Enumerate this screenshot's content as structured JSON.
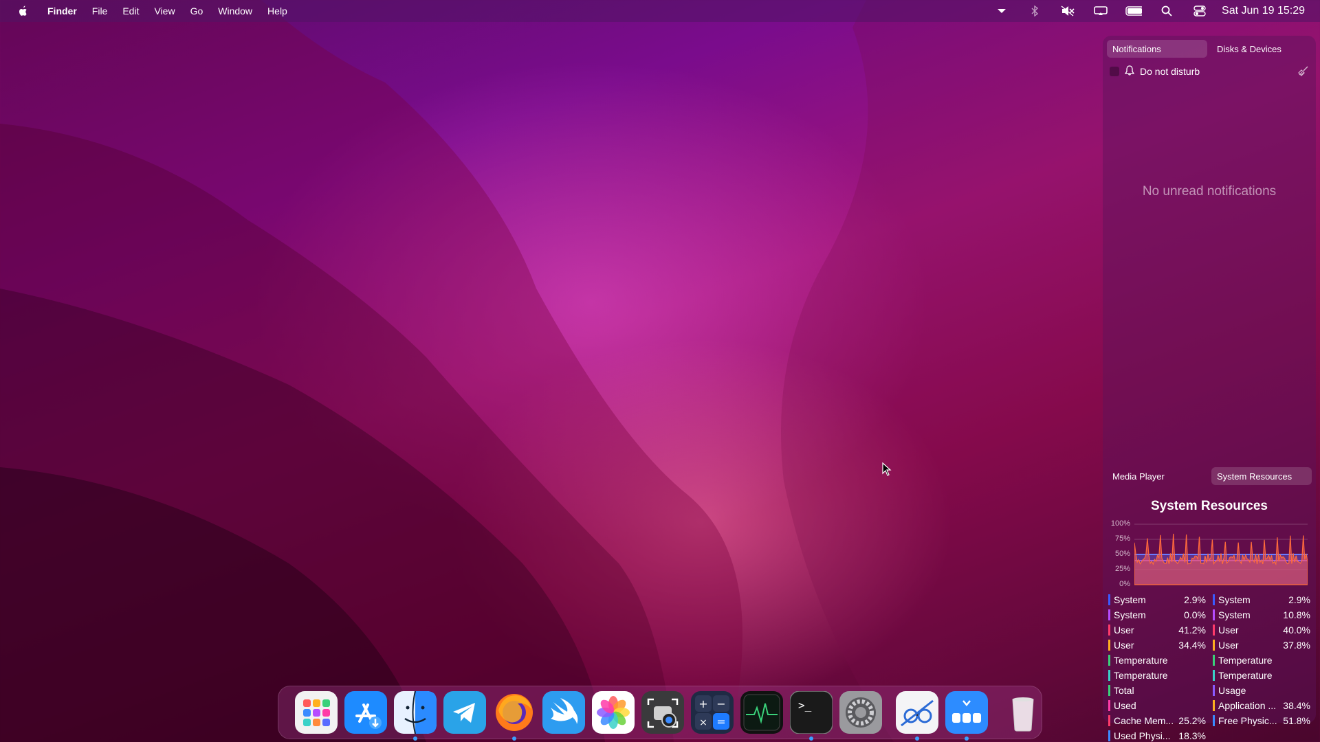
{
  "menubar": {
    "app_name": "Finder",
    "menus": [
      "File",
      "Edit",
      "View",
      "Go",
      "Window",
      "Help"
    ],
    "status_icons": [
      "chevron-down-icon",
      "bluetooth-icon",
      "mute-icon",
      "screen-mirror-icon",
      "battery-icon",
      "search-icon",
      "control-center-icon"
    ],
    "clock": "Sat Jun 19  15:29"
  },
  "panel": {
    "tabs": [
      "Notifications",
      "Disks & Devices"
    ],
    "dnd_label": "Do not disturb",
    "empty_text": "No unread notifications",
    "bottom_tabs": [
      "Media Player",
      "System Resources"
    ],
    "resources_title": "System Resources",
    "y_labels": [
      "100%",
      "75%",
      "50%",
      "25%",
      "0%"
    ],
    "left_stats": [
      {
        "label": "System",
        "value": "2.9%",
        "color": "#3b5bff"
      },
      {
        "label": "System",
        "value": "0.0%",
        "color": "#b64cff"
      },
      {
        "label": "User",
        "value": "41.2%",
        "color": "#ff3b6b"
      },
      {
        "label": "User",
        "value": "34.4%",
        "color": "#ffb020"
      },
      {
        "label": "Temperature",
        "value": "",
        "color": "#3ad17a"
      },
      {
        "label": "Temperature",
        "value": "",
        "color": "#3ad1c8"
      },
      {
        "label": "Total",
        "value": "",
        "color": "#3ad17a"
      },
      {
        "label": "Used",
        "value": "",
        "color": "#ff3ba8"
      },
      {
        "label": "Cache Mem...",
        "value": "25.2%",
        "color": "#ff3b6b"
      },
      {
        "label": "Used Physi...",
        "value": "18.3%",
        "color": "#3b8bff"
      }
    ],
    "right_stats": [
      {
        "label": "System",
        "value": "2.9%",
        "color": "#3b5bff"
      },
      {
        "label": "System",
        "value": "10.8%",
        "color": "#b64cff"
      },
      {
        "label": "User",
        "value": "40.0%",
        "color": "#ff3b6b"
      },
      {
        "label": "User",
        "value": "37.8%",
        "color": "#ffb020"
      },
      {
        "label": "Temperature",
        "value": "",
        "color": "#3ad17a"
      },
      {
        "label": "Temperature",
        "value": "",
        "color": "#3ad1c8"
      },
      {
        "label": "Usage",
        "value": "",
        "color": "#8b5bff"
      },
      {
        "label": "Application ...",
        "value": "38.4%",
        "color": "#ffb020"
      },
      {
        "label": "Free Physic...",
        "value": "51.8%",
        "color": "#3b8bff"
      }
    ]
  },
  "dock": {
    "apps": [
      {
        "name": "launchpad-icon",
        "running": false
      },
      {
        "name": "app-store-icon",
        "running": false
      },
      {
        "name": "finder-icon",
        "running": true
      },
      {
        "name": "telegram-icon",
        "running": false
      },
      {
        "name": "firefox-icon",
        "running": true
      },
      {
        "name": "swift-icon",
        "running": false
      },
      {
        "name": "photos-icon",
        "running": false
      },
      {
        "name": "screenshot-icon",
        "running": false
      },
      {
        "name": "calculator-icon",
        "running": false
      },
      {
        "name": "activity-monitor-icon",
        "running": false
      },
      {
        "name": "terminal-icon",
        "running": true
      },
      {
        "name": "system-preferences-icon",
        "running": false
      },
      {
        "name": "preview-icon",
        "running": true
      },
      {
        "name": "app-grid-icon",
        "running": true
      },
      {
        "name": "trash-icon",
        "running": false
      }
    ]
  }
}
